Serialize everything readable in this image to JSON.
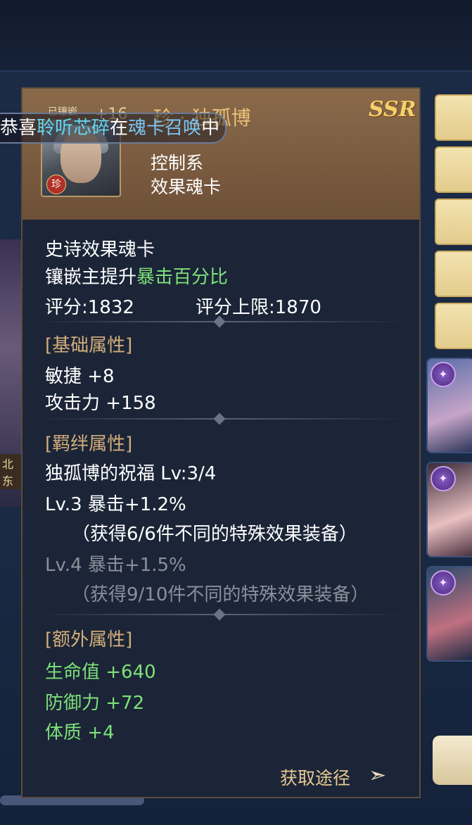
{
  "toast": {
    "prefix": "恭喜",
    "player": "聆听芯碎",
    "mid": "在",
    "place": "魂卡召唤",
    "suffix": "中"
  },
  "card": {
    "equipped": "已镶嵌",
    "plus": "+16",
    "name": "珍 · 独孤博",
    "rarity": "SSR",
    "rare_badge": "珍",
    "type1": "控制系",
    "type2": "效果魂卡"
  },
  "info": {
    "category": "史诗效果魂卡",
    "bonus_prefix": "镶嵌主提升",
    "bonus_stat": "暴击百分比",
    "score": "评分:1832",
    "score_max": "评分上限:1870"
  },
  "base_attrs": {
    "title": "[基础属性]",
    "items": [
      "敏捷 +8",
      "攻击力 +158"
    ]
  },
  "bond_attrs": {
    "title": "[羁绊属性]",
    "header": "独孤博的祝福  Lv:3/4",
    "lv3": "Lv.3 暴击+1.2%",
    "lv3_cond": "（获得6/6件不同的特殊效果装备）",
    "lv4": "Lv.4 暴击+1.5%",
    "lv4_cond": "（获得9/10件不同的特殊效果装备）"
  },
  "extra_attrs": {
    "title": "[额外属性]",
    "items": [
      "生命值 +640",
      "防御力 +72",
      "体质 +4"
    ]
  },
  "source_label": "获取途径",
  "left_label": "北东",
  "colors": {
    "green": "#7ee07a",
    "section": "#d4ad7a",
    "gold": "#f4d06a"
  }
}
